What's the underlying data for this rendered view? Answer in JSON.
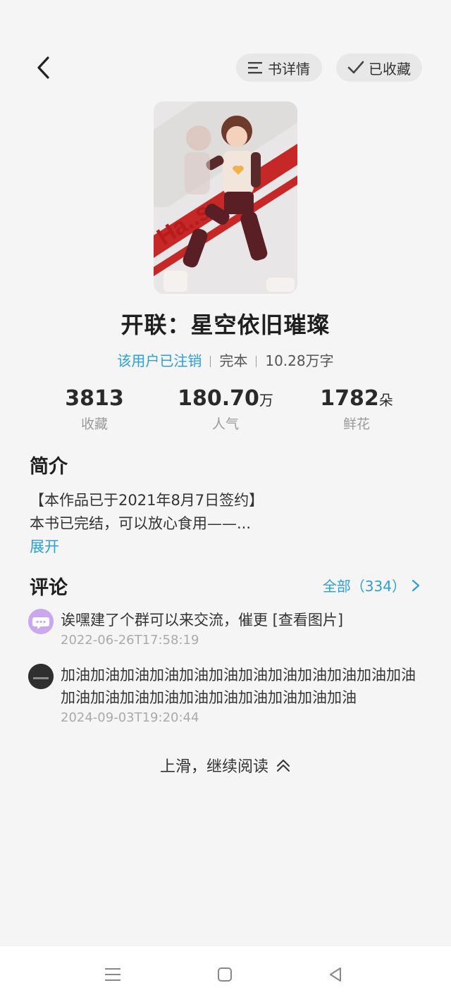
{
  "header": {
    "details_label": "书详情",
    "favorited_label": "已收藏"
  },
  "book": {
    "title": "开联：星空依旧璀璨",
    "author": "该用户已注销",
    "status": "完本",
    "word_count": "10.28万字",
    "cover_text": "Ha.. s"
  },
  "stats": [
    {
      "value": "3813",
      "unit": "",
      "label": "收藏"
    },
    {
      "value": "180.70",
      "unit": "万",
      "label": "人气"
    },
    {
      "value": "1782",
      "unit": "朵",
      "label": "鲜花"
    }
  ],
  "intro": {
    "heading": "简介",
    "line1": "【本作品已于2021年8月7日签约】",
    "line2": "本书已完结，可以放心食用——...",
    "expand_label": "展开"
  },
  "comments": {
    "heading": "评论",
    "all_label": "全部（334）",
    "items": [
      {
        "text": "诶嘿建了个群可以来交流，催更 [查看图片]",
        "time": "2022-06-26T17:58:19"
      },
      {
        "text": "加油加油加油加油加油加油加油加油加油加油加油加油加油加油加油加油加油加油加油加油加油加油",
        "time": "2024-09-03T19:20:44"
      }
    ]
  },
  "continue_label": "上滑，继续阅读",
  "colors": {
    "accent": "#2aa0d8",
    "background": "#f5f5f5"
  }
}
